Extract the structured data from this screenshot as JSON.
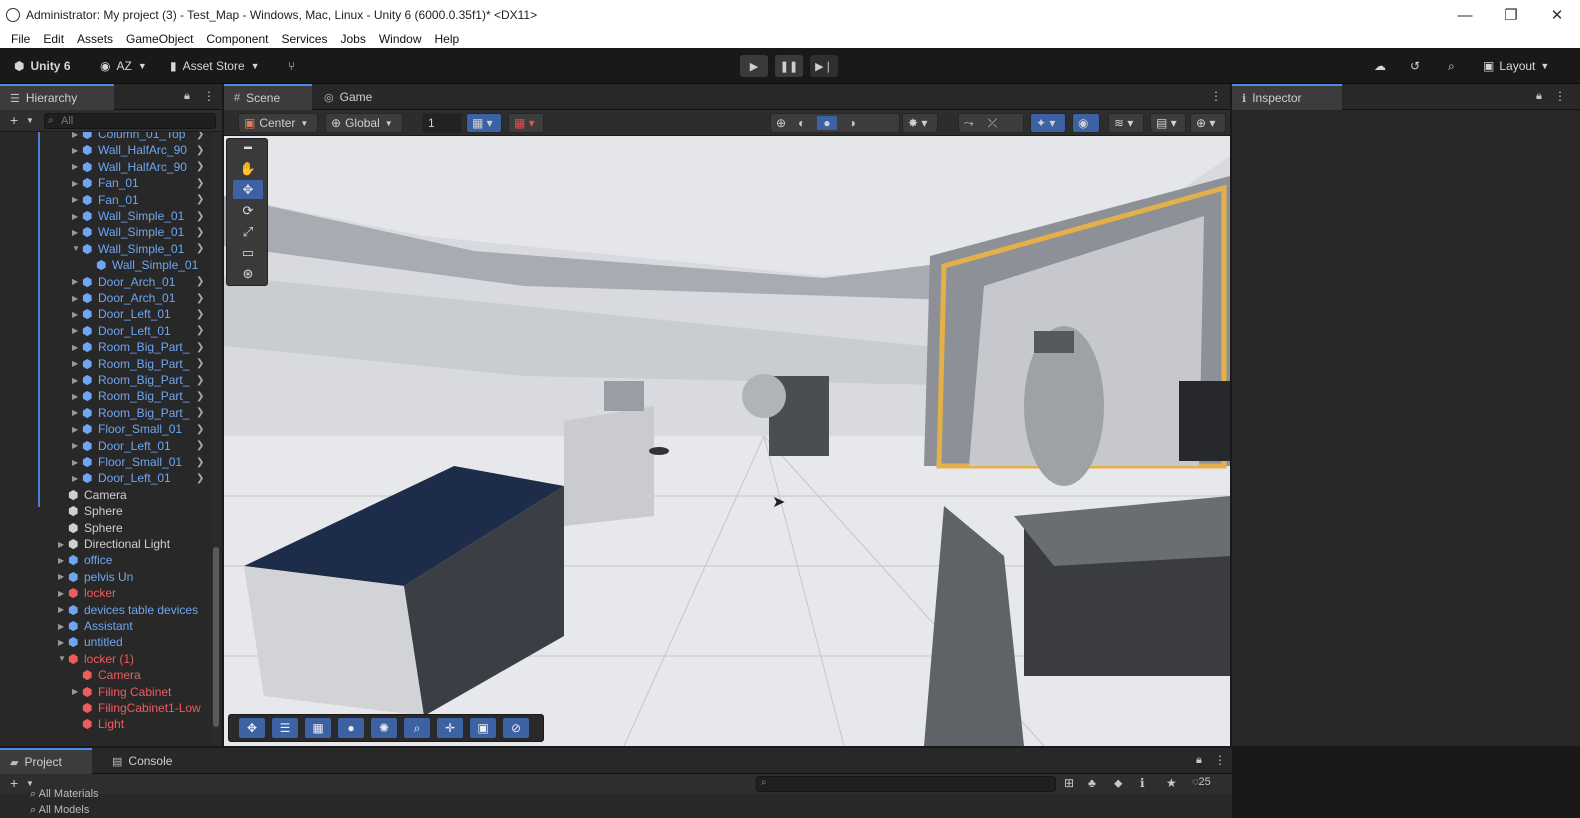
{
  "window": {
    "title": "Administrator: My project (3) - Test_Map - Windows, Mac, Linux - Unity 6 (6000.0.35f1)* <DX11>",
    "controls": [
      "—",
      "❐",
      "✕"
    ]
  },
  "menu": [
    "File",
    "Edit",
    "Assets",
    "GameObject",
    "Component",
    "Services",
    "Jobs",
    "Window",
    "Help"
  ],
  "toolbar": {
    "unity_label": "Unity 6",
    "account_label": "AZ",
    "asset_store_label": "Asset Store",
    "layout_label": "Layout"
  },
  "hierarchy": {
    "tab_label": "Hierarchy",
    "search_placeholder": "All",
    "rows": [
      {
        "label": "Column_01_Top",
        "indent": 1,
        "color": "blue",
        "arrow": "▶",
        "chev": true
      },
      {
        "label": "Wall_HalfArc_90",
        "indent": 1,
        "color": "blue",
        "arrow": "▶",
        "chev": true
      },
      {
        "label": "Wall_HalfArc_90",
        "indent": 1,
        "color": "blue",
        "arrow": "▶",
        "chev": true
      },
      {
        "label": "Fan_01",
        "indent": 1,
        "color": "blue",
        "arrow": "▶",
        "chev": true
      },
      {
        "label": "Fan_01",
        "indent": 1,
        "color": "blue",
        "arrow": "▶",
        "chev": true
      },
      {
        "label": "Wall_Simple_01",
        "indent": 1,
        "color": "blue",
        "arrow": "▶",
        "chev": true
      },
      {
        "label": "Wall_Simple_01",
        "indent": 1,
        "color": "blue",
        "arrow": "▶",
        "chev": true
      },
      {
        "label": "Wall_Simple_01",
        "indent": 1,
        "color": "blue",
        "arrow": "▼",
        "chev": true
      },
      {
        "label": "Wall_Simple_01",
        "indent": 2,
        "color": "blue",
        "arrow": "",
        "chev": false
      },
      {
        "label": "Door_Arch_01",
        "indent": 1,
        "color": "blue",
        "arrow": "▶",
        "chev": true
      },
      {
        "label": "Door_Arch_01",
        "indent": 1,
        "color": "blue",
        "arrow": "▶",
        "chev": true
      },
      {
        "label": "Door_Left_01",
        "indent": 1,
        "color": "blue",
        "arrow": "▶",
        "chev": true
      },
      {
        "label": "Door_Left_01",
        "indent": 1,
        "color": "blue",
        "arrow": "▶",
        "chev": true
      },
      {
        "label": "Room_Big_Part_",
        "indent": 1,
        "color": "blue",
        "arrow": "▶",
        "chev": true
      },
      {
        "label": "Room_Big_Part_",
        "indent": 1,
        "color": "blue",
        "arrow": "▶",
        "chev": true
      },
      {
        "label": "Room_Big_Part_",
        "indent": 1,
        "color": "blue",
        "arrow": "▶",
        "chev": true
      },
      {
        "label": "Room_Big_Part_",
        "indent": 1,
        "color": "blue",
        "arrow": "▶",
        "chev": true
      },
      {
        "label": "Room_Big_Part_",
        "indent": 1,
        "color": "blue",
        "arrow": "▶",
        "chev": true
      },
      {
        "label": "Floor_Small_01",
        "indent": 1,
        "color": "blue",
        "arrow": "▶",
        "chev": true
      },
      {
        "label": "Door_Left_01",
        "indent": 1,
        "color": "blue",
        "arrow": "▶",
        "chev": true
      },
      {
        "label": "Floor_Small_01",
        "indent": 1,
        "color": "blue",
        "arrow": "▶",
        "chev": true
      },
      {
        "label": "Door_Left_01",
        "indent": 1,
        "color": "blue",
        "arrow": "▶",
        "chev": true
      },
      {
        "label": "Camera",
        "indent": 0,
        "color": "white",
        "arrow": "",
        "chev": false
      },
      {
        "label": "Sphere",
        "indent": 0,
        "color": "white",
        "arrow": "",
        "chev": false
      },
      {
        "label": "Sphere",
        "indent": 0,
        "color": "white",
        "arrow": "",
        "chev": false
      },
      {
        "label": "Directional Light",
        "indent": 0,
        "color": "white",
        "arrow": "▶",
        "chev": false
      },
      {
        "label": "office",
        "indent": 0,
        "color": "blue",
        "arrow": "▶",
        "chev": false
      },
      {
        "label": "pelvis Un",
        "indent": 0,
        "color": "blue",
        "arrow": "▶",
        "chev": false
      },
      {
        "label": "locker",
        "indent": 0,
        "color": "red",
        "arrow": "▶",
        "chev": false
      },
      {
        "label": "devices table devices",
        "indent": 0,
        "color": "blue",
        "arrow": "▶",
        "chev": false
      },
      {
        "label": "Assistant",
        "indent": 0,
        "color": "blue",
        "arrow": "▶",
        "chev": false
      },
      {
        "label": "untitled",
        "indent": 0,
        "color": "blue",
        "arrow": "▶",
        "chev": false
      },
      {
        "label": "locker (1)",
        "indent": 0,
        "color": "red",
        "arrow": "▼",
        "chev": false
      },
      {
        "label": "Camera",
        "indent": 1,
        "color": "red",
        "arrow": "",
        "chev": false
      },
      {
        "label": "Filing Cabinet",
        "indent": 1,
        "color": "red",
        "arrow": "▶",
        "chev": false
      },
      {
        "label": "FilingCabinet1-Low",
        "indent": 1,
        "color": "red",
        "arrow": "",
        "chev": false
      },
      {
        "label": "Light",
        "indent": 1,
        "color": "red",
        "arrow": "",
        "chev": false
      }
    ]
  },
  "scene": {
    "tab_scene": "Scene",
    "tab_game": "Game",
    "pivot_label": "Center",
    "space_label": "Global",
    "grid_value": "1"
  },
  "inspector": {
    "tab_label": "Inspector"
  },
  "project": {
    "tab_project": "Project",
    "tab_console": "Console",
    "filters": [
      "All Materials",
      "All Models"
    ],
    "count": "25"
  },
  "colors": {
    "accent": "#3c62a4",
    "hier_blue": "#6fa6f2",
    "hier_red": "#f05b5b"
  }
}
